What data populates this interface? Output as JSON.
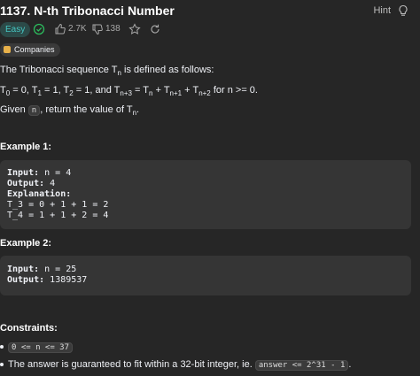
{
  "header": {
    "title": "1137. N-th Tribonacci Number",
    "hint_label": "Hint"
  },
  "meta": {
    "difficulty": "Easy",
    "likes": "2.7K",
    "dislikes": "138"
  },
  "companies_label": "Companies",
  "description": {
    "intro_prefix": "The Tribonacci sequence T",
    "intro_sub": "n",
    "intro_suffix": " is defined as follows:",
    "def_line": {
      "t0": "T",
      "t0_sub": "0",
      "t0_rest": " = 0, T",
      "t1_sub": "1",
      "t1_rest": " = 1, T",
      "t2_sub": "2",
      "t2_rest": " = 1, and T",
      "tn3_sub": "n+3",
      "tn3_rest": " = T",
      "tn_sub": "n",
      "tn_rest": " + T",
      "tn1_sub": "n+1",
      "tn1_rest": " + T",
      "tn2_sub": "n+2",
      "tn2_rest": " for n >= 0."
    },
    "given_prefix": "Given ",
    "given_code": "n",
    "given_mid": ", return the value of T",
    "given_sub": "n",
    "given_suffix": "."
  },
  "example1": {
    "heading": "Example 1:",
    "input_label": "Input:",
    "input_value": " n = 4",
    "output_label": "Output:",
    "output_value": " 4",
    "explanation_label": "Explanation:",
    "line1": "T_3 = 0 + 1 + 1 = 2",
    "line2": "T_4 = 1 + 1 + 2 = 4"
  },
  "example2": {
    "heading": "Example 2:",
    "input_label": "Input:",
    "input_value": " n = 25",
    "output_label": "Output:",
    "output_value": " 1389537"
  },
  "constraints": {
    "heading": "Constraints:",
    "c1_code": "0 <= n <= 37",
    "c2_text": "The answer is guaranteed to fit within a 32-bit integer, ie. ",
    "c2_code": "answer <= 2^31 - 1",
    "c2_end": "."
  },
  "colors": {
    "background": "#262626",
    "easy": "#46c6c2",
    "accepted_check": "#2cbb5d"
  },
  "icons": [
    "lightbulb-icon",
    "check-circle-icon",
    "thumbs-up-icon",
    "thumbs-down-icon",
    "star-icon",
    "share-icon",
    "lock-icon"
  ]
}
